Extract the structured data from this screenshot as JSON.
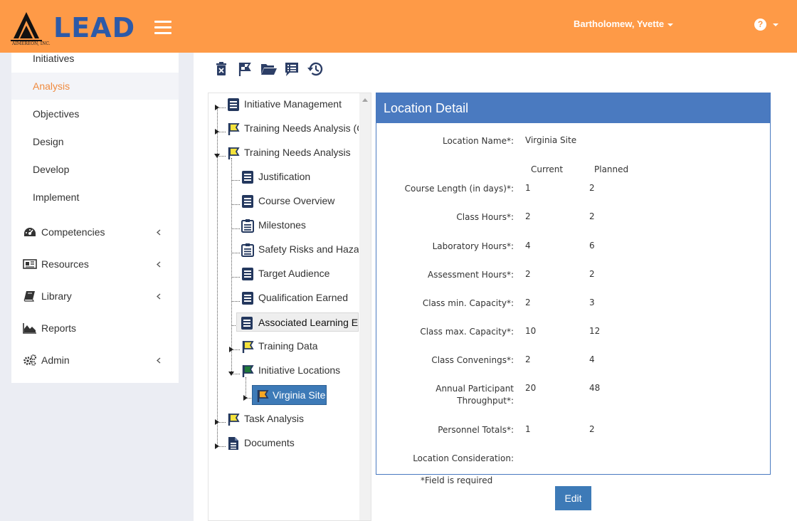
{
  "app": {
    "logo_text": "LEAD",
    "logo_sub": "AIMEREON, INC.",
    "user_name": "Bartholomew, Yvette",
    "help_glyph": "?",
    "brand_color": "#fe9a47",
    "accent_color": "#4a7ac0"
  },
  "sidebar": {
    "sub_items": [
      {
        "label": "Initiatives"
      },
      {
        "label": "Analysis",
        "active": true
      },
      {
        "label": "Objectives"
      },
      {
        "label": "Design"
      },
      {
        "label": "Develop"
      },
      {
        "label": "Implement"
      }
    ],
    "main_items": [
      {
        "label": "Competencies",
        "icon": "dashboard-icon",
        "expandable": true
      },
      {
        "label": "Resources",
        "icon": "newspaper-icon",
        "expandable": true
      },
      {
        "label": "Library",
        "icon": "book-icon",
        "expandable": true
      },
      {
        "label": "Reports",
        "icon": "area-chart-icon",
        "expandable": false
      },
      {
        "label": "Admin",
        "icon": "cogs-icon",
        "expandable": true
      }
    ]
  },
  "toolbar": {
    "buttons": [
      "delete-icon",
      "flag-icon",
      "folder-open-icon",
      "list-alt-icon",
      "history-icon"
    ]
  },
  "tree": {
    "nodes": [
      {
        "label": "Initiative Management",
        "icon": "document-icon"
      },
      {
        "label": "Training Needs Analysis (C",
        "icon": "yellow-flag-icon"
      },
      {
        "label": "Training Needs Analysis",
        "icon": "yellow-flag-icon"
      },
      {
        "label": "Justification",
        "icon": "document-icon"
      },
      {
        "label": "Course Overview",
        "icon": "document-icon"
      },
      {
        "label": "Milestones",
        "icon": "clipboard-icon"
      },
      {
        "label": "Safety Risks and Haza",
        "icon": "clipboard-icon"
      },
      {
        "label": "Target Audience",
        "icon": "document-icon"
      },
      {
        "label": "Qualification Earned",
        "icon": "document-icon"
      },
      {
        "label": "Associated Learning Ev",
        "icon": "document-icon"
      },
      {
        "label": "Training Data",
        "icon": "yellow-flag-icon"
      },
      {
        "label": "Initiative Locations",
        "icon": "green-flag-icon"
      },
      {
        "label": "Virginia Site",
        "icon": "orange-flag-icon",
        "selected": true
      },
      {
        "label": "Task Analysis",
        "icon": "yellow-flag-icon"
      },
      {
        "label": "Documents",
        "icon": "file-icon"
      }
    ]
  },
  "detail": {
    "title": "Location Detail",
    "location_name_label": "Location Name*:",
    "location_name_value": "Virginia Site",
    "col_current": "Current",
    "col_planned": "Planned",
    "rows": [
      {
        "label": "Course Length (in days)*:",
        "current": "1",
        "planned": "2"
      },
      {
        "label": "Class Hours*:",
        "current": "2",
        "planned": "2"
      },
      {
        "label": "Laboratory Hours*:",
        "current": "4",
        "planned": "6"
      },
      {
        "label": "Assessment Hours*:",
        "current": "2",
        "planned": "2"
      },
      {
        "label": "Class min. Capacity*:",
        "current": "2",
        "planned": "3"
      },
      {
        "label": "Class max. Capacity*:",
        "current": "10",
        "planned": "12"
      },
      {
        "label": "Class Convenings*:",
        "current": "2",
        "planned": "4"
      },
      {
        "label": "Annual Participant Throughput*:",
        "current": "20",
        "planned": "48"
      },
      {
        "label": "Personnel Totals*:",
        "current": "1",
        "planned": "2"
      }
    ],
    "consideration_label": "Location Consideration:",
    "required_note": "*Field is required",
    "edit_label": "Edit"
  }
}
